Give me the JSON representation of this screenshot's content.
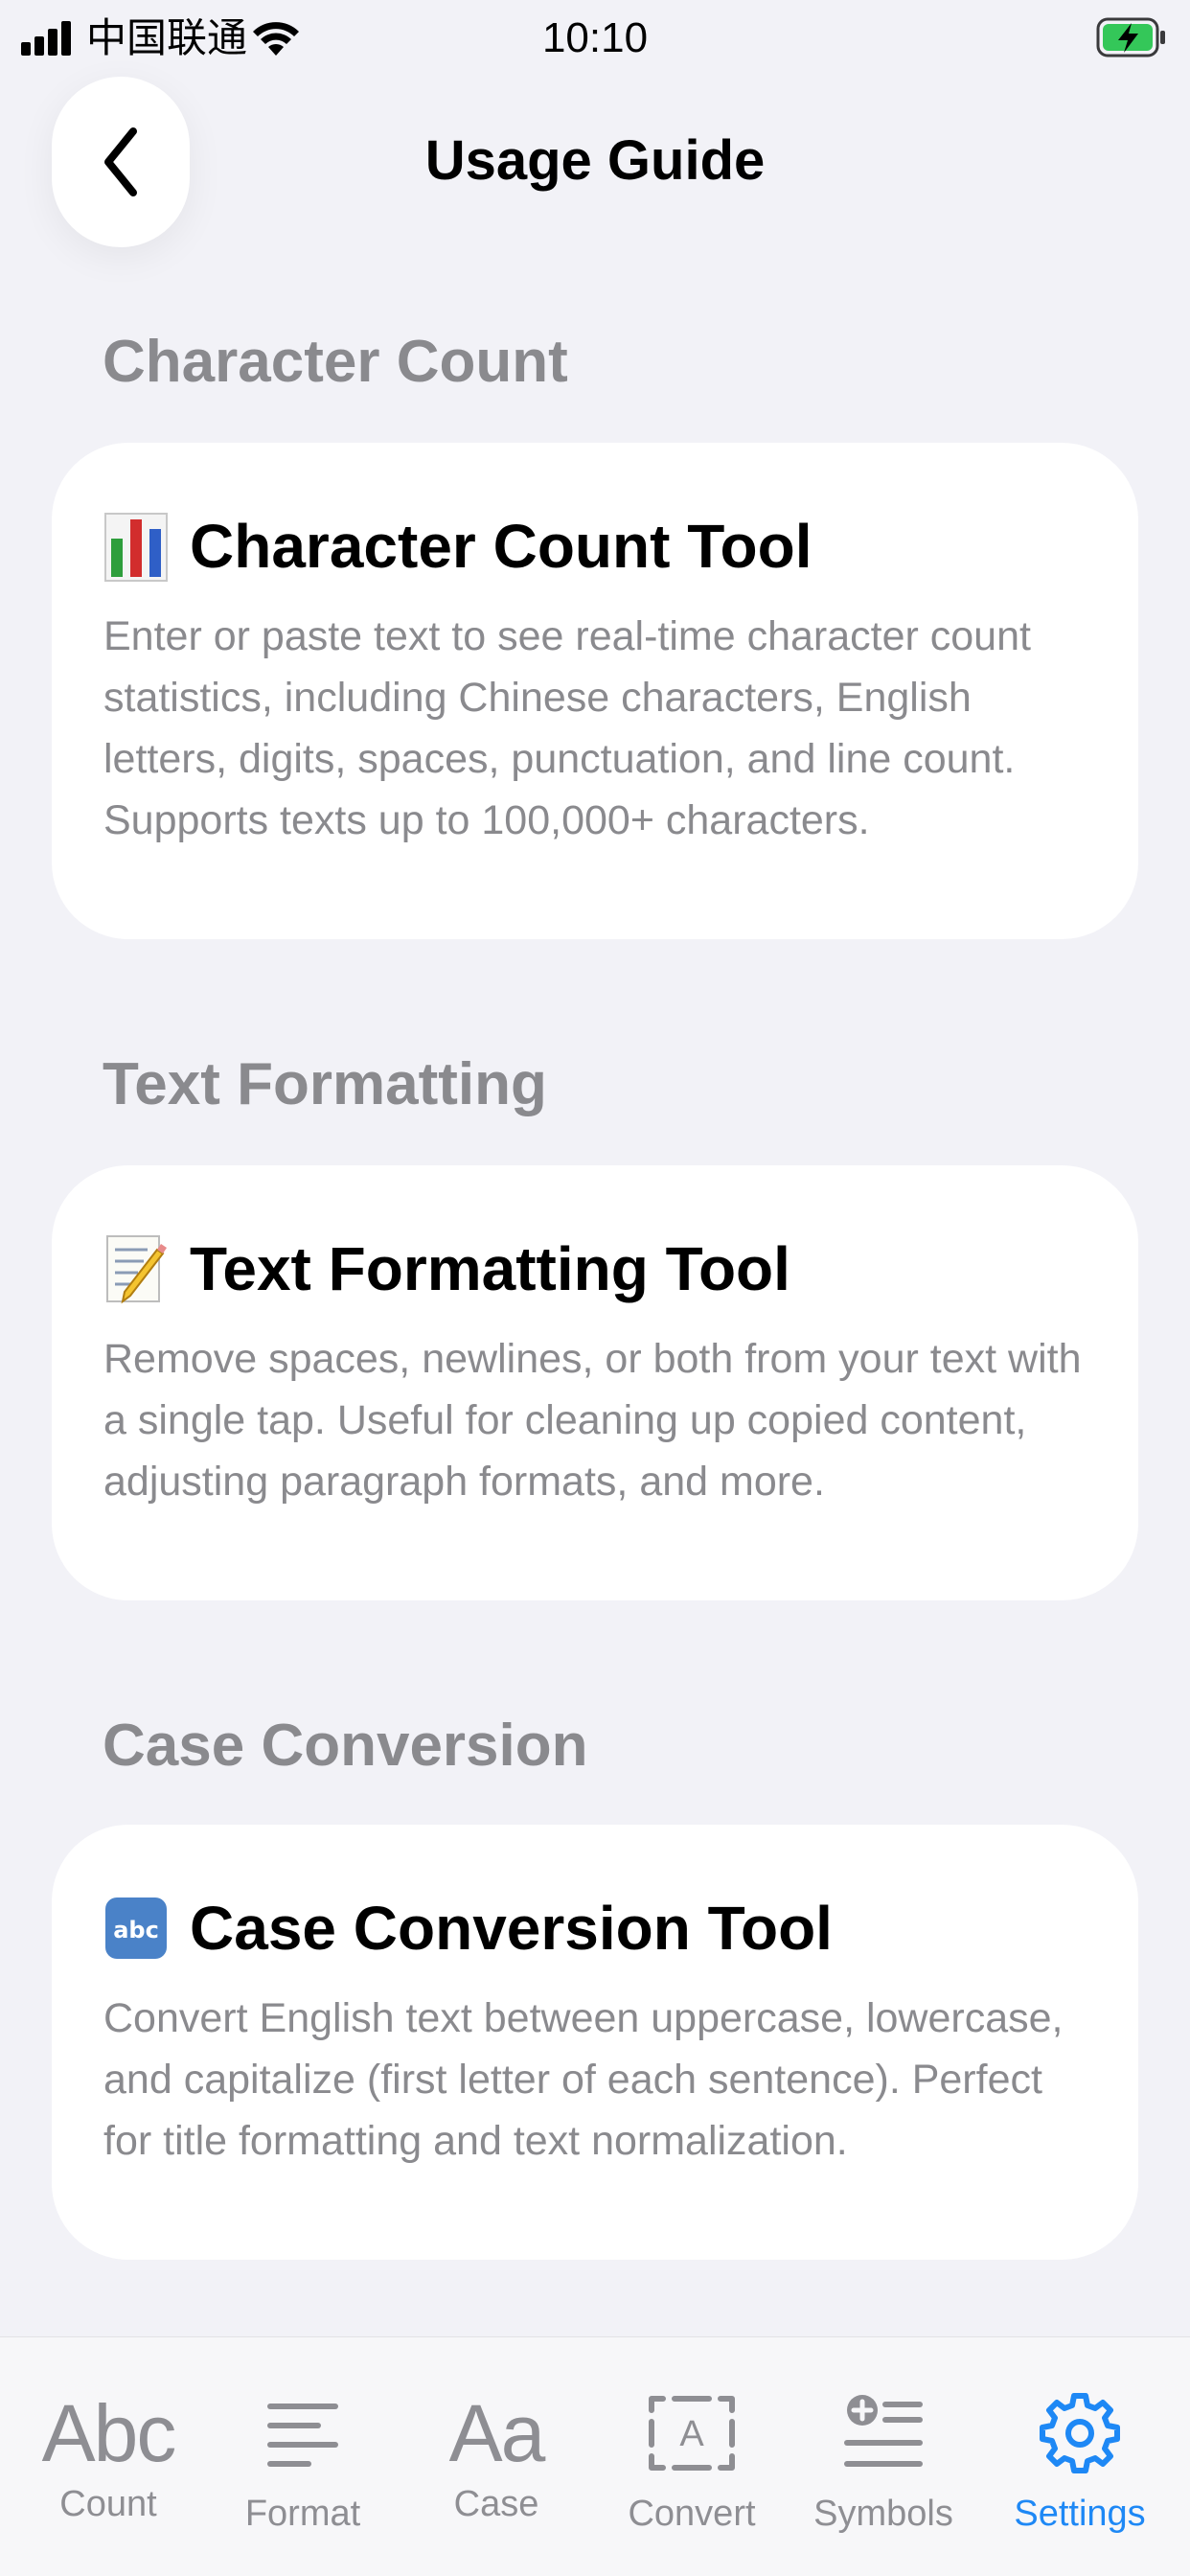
{
  "status_bar": {
    "carrier": "中国联通",
    "time": "10:10"
  },
  "nav": {
    "title": "Usage Guide"
  },
  "sections": [
    {
      "header": "Character Count",
      "card_title": "Character Count Tool",
      "card_icon": "bar-chart-emoji-icon",
      "card_body": "Enter or paste text to see real-time character count statistics, including Chinese characters, English letters, digits, spaces, punctuation, and line count. Supports texts up to 100,000+ characters."
    },
    {
      "header": "Text Formatting",
      "card_title": "Text Formatting Tool",
      "card_icon": "memo-emoji-icon",
      "card_body": "Remove spaces, newlines, or both from your text with a single tap. Useful for cleaning up copied content, adjusting paragraph formats, and more."
    },
    {
      "header": "Case Conversion",
      "card_title": "Case Conversion Tool",
      "card_icon": "abc-emoji-icon",
      "card_body": "Convert English text between uppercase, lowercase, and capitalize (first letter of each sentence). Perfect for title formatting and text normalization."
    }
  ],
  "tab_bar": {
    "active_color": "#1e88f5",
    "inactive_color": "#8e8e93",
    "tabs": [
      {
        "label": "Count",
        "icon": "abc-text-icon",
        "icon_text": "Abc",
        "active": false
      },
      {
        "label": "Format",
        "icon": "lines-icon",
        "active": false
      },
      {
        "label": "Case",
        "icon": "aa-text-icon",
        "icon_text": "Aa",
        "active": false
      },
      {
        "label": "Convert",
        "icon": "a-box-icon",
        "icon_text": "A",
        "active": false
      },
      {
        "label": "Symbols",
        "icon": "list-plus-icon",
        "active": false
      },
      {
        "label": "Settings",
        "icon": "gear-icon",
        "active": true
      }
    ]
  }
}
